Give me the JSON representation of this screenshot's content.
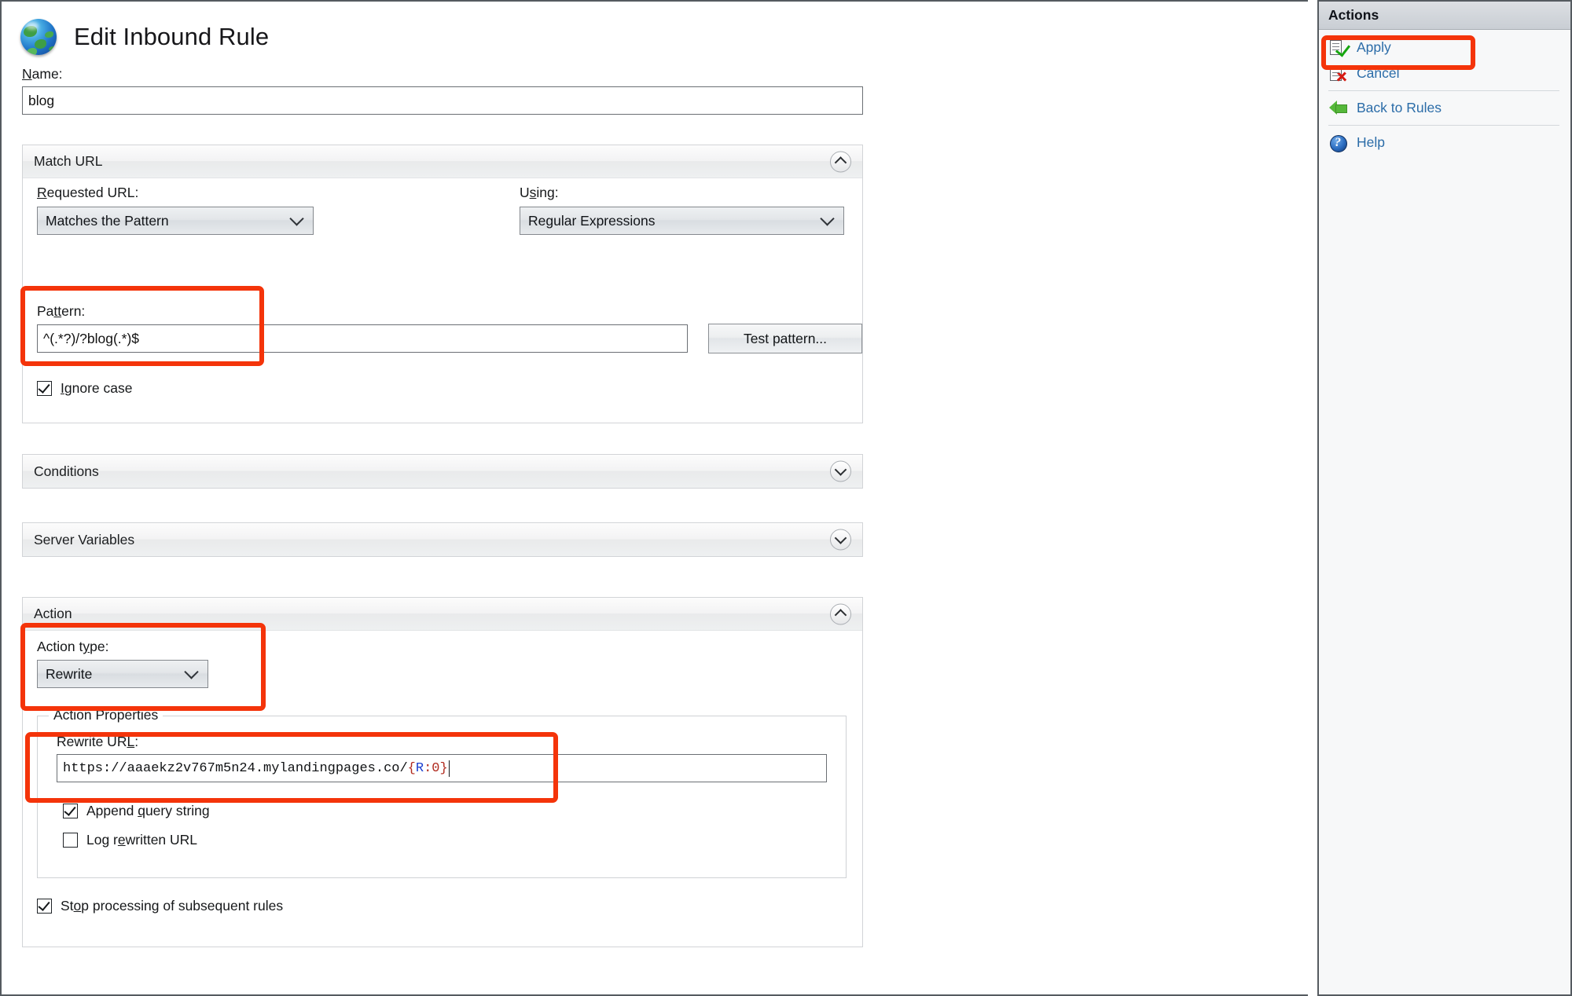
{
  "window": {
    "title": "Edit Inbound Rule"
  },
  "header": {
    "icon": "globe-icon",
    "title": "Edit Inbound Rule",
    "name_label_pre": "N",
    "name_label_post": "ame:",
    "name_value": "blog"
  },
  "match_url": {
    "section_title": "Match URL",
    "expanded": true,
    "requested_url_label_pre": "R",
    "requested_url_label_post": "equested URL:",
    "requested_url_value": "Matches the Pattern",
    "using_label_pre": "U",
    "using_label_mid": "s",
    "using_label_post": "ing:",
    "using_value": "Regular Expressions",
    "pattern_label_pre": "Pa",
    "pattern_label_mid": "tt",
    "pattern_label_post": "ern:",
    "pattern_value": "^(.*?)/?blog(.*)$",
    "test_pattern_label": "Test pattern...",
    "ignore_case_label_pre": "I",
    "ignore_case_label_post": "gnore case",
    "ignore_case_checked": true
  },
  "conditions": {
    "section_title": "Conditions",
    "expanded": false
  },
  "server_variables": {
    "section_title": "Server Variables",
    "expanded": false
  },
  "action": {
    "section_title": "Action",
    "expanded": true,
    "action_type_label_pre": "Action t",
    "action_type_label_mid": "y",
    "action_type_label_post": "pe:",
    "action_type_value": "Rewrite",
    "properties_legend": "Action Properties",
    "rewrite_url_label_pre": "Rewrite UR",
    "rewrite_url_label_mid": "L",
    "rewrite_url_label_post": ":",
    "rewrite_url_prefix": "https://aaaekz2v767m5n24.mylandingpages.co/",
    "rewrite_url_token_open": "{",
    "rewrite_url_token_var": "R",
    "rewrite_url_token_colon": ":",
    "rewrite_url_token_num": "0",
    "rewrite_url_token_close": "}",
    "rewrite_url_full": "https://aaaekz2v767m5n24.mylandingpages.co/{R:0}",
    "append_query_label_pre": "Append ",
    "append_query_label_mid": "q",
    "append_query_label_post": "uery string",
    "append_query_checked": true,
    "log_rewritten_label_pre": "Log r",
    "log_rewritten_label_mid": "e",
    "log_rewritten_label_post": "written URL",
    "log_rewritten_checked": false,
    "stop_processing_label_pre": "St",
    "stop_processing_label_mid": "o",
    "stop_processing_label_post": "p processing of subsequent rules",
    "stop_processing_checked": true
  },
  "actions_panel": {
    "title": "Actions",
    "items": [
      {
        "label": "Apply",
        "icon": "document-check-icon"
      },
      {
        "label": "Cancel",
        "icon": "document-x-icon"
      },
      {
        "label": "Back to Rules",
        "icon": "arrow-left-icon"
      },
      {
        "label": "Help",
        "icon": "help-circle-icon"
      }
    ]
  },
  "annotations": {
    "highlight_color": "#f4340a",
    "targets": [
      "pattern-field",
      "action-type-field",
      "rewrite-url-field",
      "apply-action"
    ]
  }
}
